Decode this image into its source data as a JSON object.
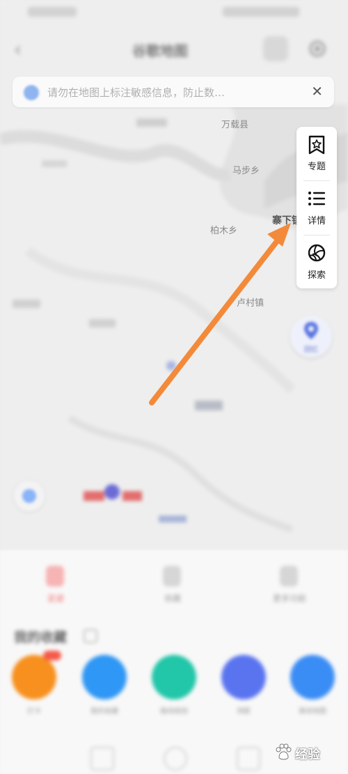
{
  "header": {
    "title": "谷歌地图",
    "back_icon": "chevron-left-icon",
    "layers_icon": "layers-icon",
    "settings_icon": "gear-icon"
  },
  "notice": {
    "text": "请勿在地图上标注敏感信息，防止数…",
    "close_icon": "close-icon",
    "visible_text": "防止数…"
  },
  "map_labels": {
    "wanzai": "万载县",
    "mabu": "马步乡",
    "baishui": "柏木乡",
    "zhaxia": "寨下镇",
    "lucun": "卢村镇"
  },
  "side_panel": {
    "items": [
      {
        "label": "专题",
        "icon": "bookmark-star-icon"
      },
      {
        "label": "详情",
        "icon": "list-icon"
      },
      {
        "label": "探索",
        "icon": "aperture-icon"
      }
    ]
  },
  "memo_button": {
    "label": "回忆",
    "icon": "map-pin-icon"
  },
  "bottom_tabs": [
    {
      "label": "足迹",
      "color": "#f36b6b"
    },
    {
      "label": "收藏",
      "color": "#bdbdbd"
    },
    {
      "label": "更多功能",
      "color": "#bdbdbd"
    }
  ],
  "section": {
    "title": "我的收藏"
  },
  "apps": [
    {
      "label": "打卡",
      "color": "#f7901e"
    },
    {
      "label": "我的收藏",
      "color": "#2f97f5"
    },
    {
      "label": "路线规划",
      "color": "#22c6a9"
    },
    {
      "label": "测距",
      "color": "#5a74f0"
    },
    {
      "label": "离线地图",
      "color": "#3a8df5"
    }
  ],
  "watermark": {
    "text": "经验",
    "icon": "baidu-paw-icon"
  },
  "accent": {
    "arrow": "#f38a3a"
  }
}
